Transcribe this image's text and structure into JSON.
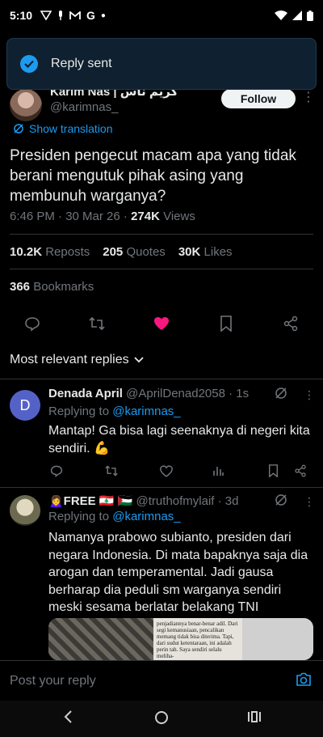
{
  "status_bar": {
    "time": "5:10"
  },
  "toast": {
    "message": "Reply sent"
  },
  "author": {
    "name": "Karim Nas | كريم ناس",
    "handle": "@karimnas_",
    "follow_label": "Follow"
  },
  "translate_label": "Show translation",
  "tweet": {
    "text": "Presiden pengecut macam apa yang tidak berani mengutuk pihak asing yang membunuh warganya?",
    "time": "6:46 PM · 30 Mar 26 · ",
    "views_count": "274K",
    "views_label": " Views"
  },
  "stats": {
    "reposts_count": "10.2K",
    "reposts_label": "Reposts",
    "quotes_count": "205",
    "quotes_label": "Quotes",
    "likes_count": "30K",
    "likes_label": "Likes",
    "bookmarks_count": "366",
    "bookmarks_label": "Bookmarks"
  },
  "sort_label": "Most relevant replies",
  "replies": [
    {
      "name": "Denada April",
      "handle": " @AprilDenad2058 · 1s",
      "avatar_letter": "D",
      "replying_prefix": "Replying to ",
      "replying_handle": "@karimnas_",
      "text": "Mantap! Ga bisa lagi seenaknya di negeri kita sendiri. 💪"
    },
    {
      "name": "🙍‍♀️FREE 🇱🇧 🇵🇸",
      "handle": " @truthofmylaif · 3d",
      "replying_prefix": "Replying to ",
      "replying_handle": "@karimnas_",
      "text": "Namanya prabowo subianto, presiden dari negara Indonesia. Di mata bapaknya saja dia arogan dan temperamental. Jadi gausa berharap dia peduli sm warganya sendiri meski sesama berlatar belakang TNI",
      "media_text": "penjadiannya benar-benar adil. Dari segi kemanusiaan, pencalikan memang tidak bisa diterima. Tapi, dari sudut ketentaraan, ini adalah perin tah. Saya sendiri selalu meliha-"
    }
  ],
  "compose": {
    "placeholder": "Post your reply"
  },
  "colors": {
    "accent": "#1d9bf0",
    "like": "#f91880",
    "background": "#000000"
  }
}
